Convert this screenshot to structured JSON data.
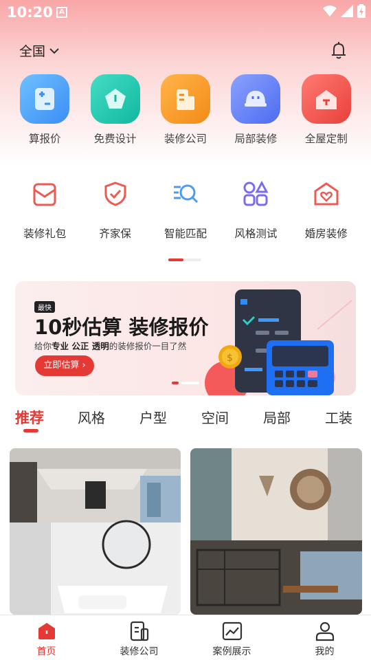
{
  "status": {
    "time": "10:20",
    "notif_icon": "A"
  },
  "location": {
    "label": "全国"
  },
  "quick_menu": [
    {
      "label": "算报价",
      "icon": "calculator-icon",
      "color": "#3a9df5"
    },
    {
      "label": "免费设计",
      "icon": "pentagon-icon",
      "color": "#1fc6b0"
    },
    {
      "label": "装修公司",
      "icon": "building-icon",
      "color": "#f7941e"
    },
    {
      "label": "局部装修",
      "icon": "helmet-icon",
      "color": "#5b7cf6"
    },
    {
      "label": "全屋定制",
      "icon": "house-icon",
      "color": "#f0534f"
    }
  ],
  "services": [
    {
      "label": "装修礼包",
      "icon": "gift-icon",
      "color": "#ee5a52"
    },
    {
      "label": "齐家保",
      "icon": "shield-icon",
      "color": "#ee5a52"
    },
    {
      "label": "智能匹配",
      "icon": "match-icon",
      "color": "#4d9bf0"
    },
    {
      "label": "风格测试",
      "icon": "style-icon",
      "color": "#7a6cf2"
    },
    {
      "label": "婚房装修",
      "icon": "heart-house-icon",
      "color": "#ee5a52"
    }
  ],
  "banner": {
    "tag": "最快",
    "title": "10秒估算 装修报价",
    "sub_prefix": "给你",
    "sub_bold": "专业 公正 透明",
    "sub_suffix": "的装修报价一目了然",
    "button": "立即估算 ›"
  },
  "tabs": [
    {
      "label": "推荐",
      "active": true
    },
    {
      "label": "风格"
    },
    {
      "label": "户型"
    },
    {
      "label": "空间"
    },
    {
      "label": "局部"
    },
    {
      "label": "工装"
    }
  ],
  "bottom_nav": [
    {
      "label": "首页",
      "icon": "home-icon",
      "active": true
    },
    {
      "label": "装修公司",
      "icon": "company-icon"
    },
    {
      "label": "案例展示",
      "icon": "gallery-icon"
    },
    {
      "label": "我的",
      "icon": "profile-icon"
    }
  ],
  "colors": {
    "accent": "#e53935"
  }
}
